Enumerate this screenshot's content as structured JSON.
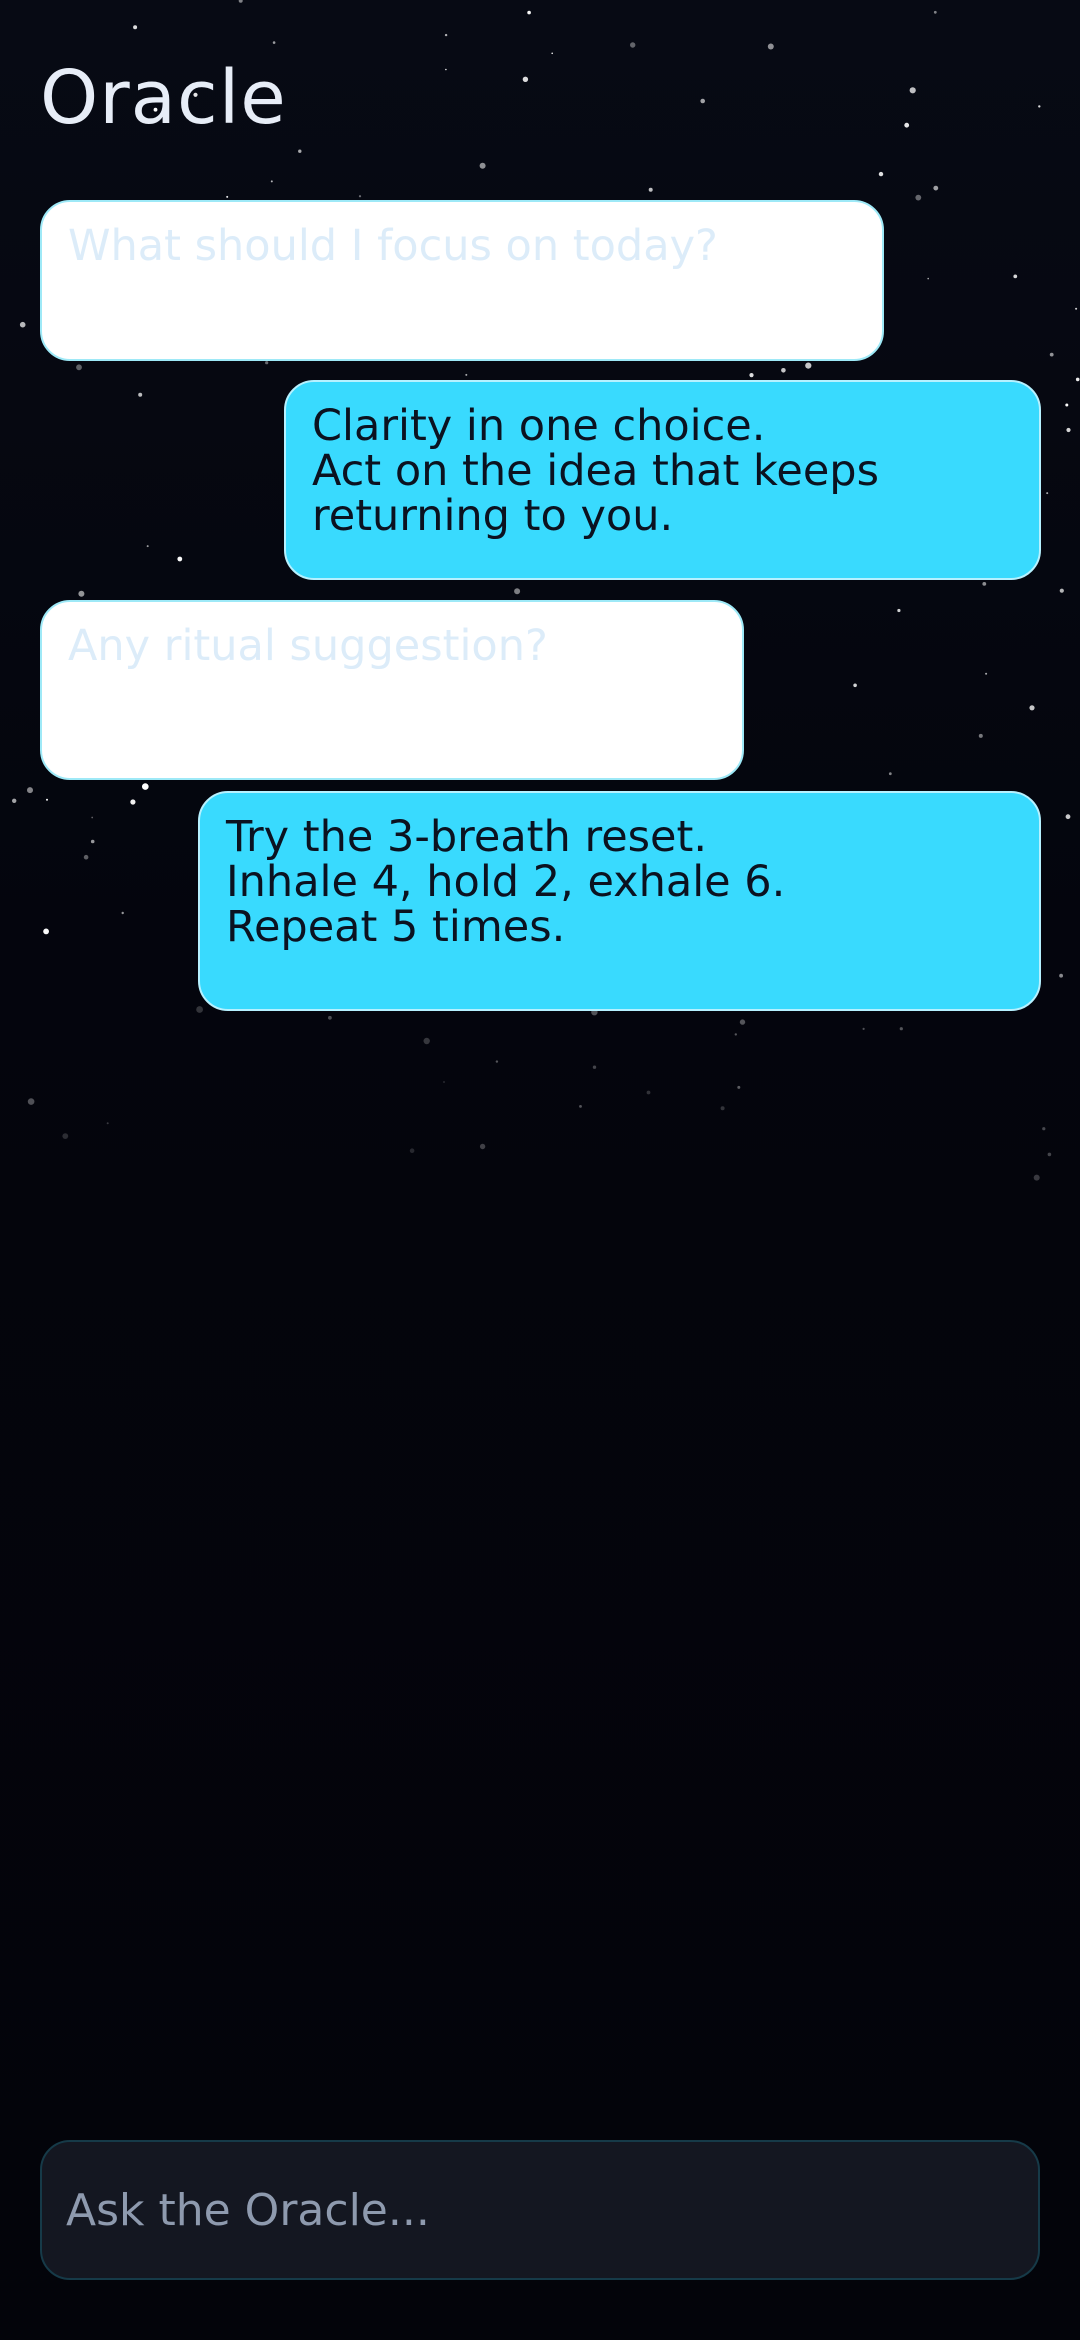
{
  "app": {
    "title": "Oracle"
  },
  "messages": [
    {
      "role": "user",
      "text": "What should I focus on today?"
    },
    {
      "role": "oracle",
      "text": "Clarity in one choice.\nAct on the idea that keeps\nreturning to you."
    },
    {
      "role": "user",
      "text": "Any ritual suggestion?"
    },
    {
      "role": "oracle",
      "text": "Try the 3-breath reset.\nInhale 4, hold 2, exhale 6.\nRepeat 5 times."
    }
  ],
  "composer": {
    "placeholder": "Ask the Oracle...",
    "value": ""
  },
  "colors": {
    "background": "#04050c",
    "oracle_bubble": "#39dafe",
    "user_bubble": "#ffffff",
    "title_text": "#e7edf7"
  }
}
